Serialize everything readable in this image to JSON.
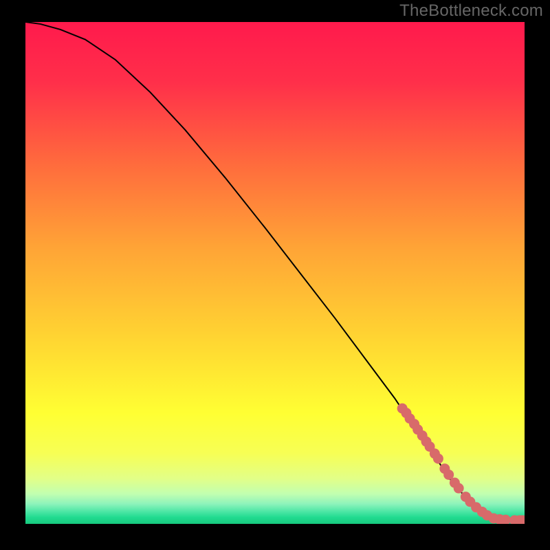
{
  "watermark": {
    "text": "TheBottleneck.com"
  },
  "chart_data": {
    "type": "line",
    "title": "",
    "xlabel": "",
    "ylabel": "",
    "xlim": [
      0,
      100
    ],
    "ylim": [
      0,
      100
    ],
    "grid": false,
    "legend": false,
    "curve": {
      "name": "bottleneck-curve",
      "x": [
        0,
        3,
        7,
        12,
        18,
        25,
        32,
        40,
        48,
        55,
        62,
        68,
        74,
        78,
        82,
        85,
        88,
        90,
        92,
        94,
        96,
        98,
        100
      ],
      "y": [
        100,
        99.6,
        98.5,
        96.5,
        92.5,
        86,
        78.5,
        69,
        59,
        50,
        41,
        33,
        25,
        19,
        13.5,
        9,
        5.5,
        3.2,
        1.8,
        1.0,
        0.8,
        0.7,
        0.7
      ]
    },
    "highlight_points": {
      "name": "highlight-points",
      "color": "#d86a6a",
      "x": [
        75.5,
        76.3,
        77.0,
        77.9,
        78.6,
        79.5,
        80.3,
        81.0,
        82.0,
        82.7,
        84.0,
        84.8,
        86.0,
        86.8,
        88.2,
        89.1,
        90.3,
        91.5,
        92.5,
        93.8,
        95.0,
        96.2,
        98.0,
        99.0,
        99.6
      ],
      "y": [
        23.0,
        22.1,
        21.0,
        19.9,
        18.8,
        17.6,
        16.4,
        15.4,
        14.0,
        13.0,
        11.0,
        9.8,
        8.2,
        7.1,
        5.4,
        4.4,
        3.3,
        2.4,
        1.7,
        1.1,
        0.9,
        0.8,
        0.7,
        0.7,
        0.7
      ]
    },
    "background_gradient": {
      "stops": [
        {
          "pct": 0,
          "color": "#ff1a4c"
        },
        {
          "pct": 12,
          "color": "#ff2f4a"
        },
        {
          "pct": 28,
          "color": "#ff6a3d"
        },
        {
          "pct": 45,
          "color": "#ffa436"
        },
        {
          "pct": 62,
          "color": "#ffd232"
        },
        {
          "pct": 78,
          "color": "#ffff33"
        },
        {
          "pct": 86,
          "color": "#f7ff55"
        },
        {
          "pct": 91,
          "color": "#e2ff88"
        },
        {
          "pct": 94,
          "color": "#c2ffb0"
        },
        {
          "pct": 96,
          "color": "#8ef3bb"
        },
        {
          "pct": 97.5,
          "color": "#4fe7a6"
        },
        {
          "pct": 98.7,
          "color": "#21db90"
        },
        {
          "pct": 100,
          "color": "#17c97e"
        }
      ]
    }
  }
}
